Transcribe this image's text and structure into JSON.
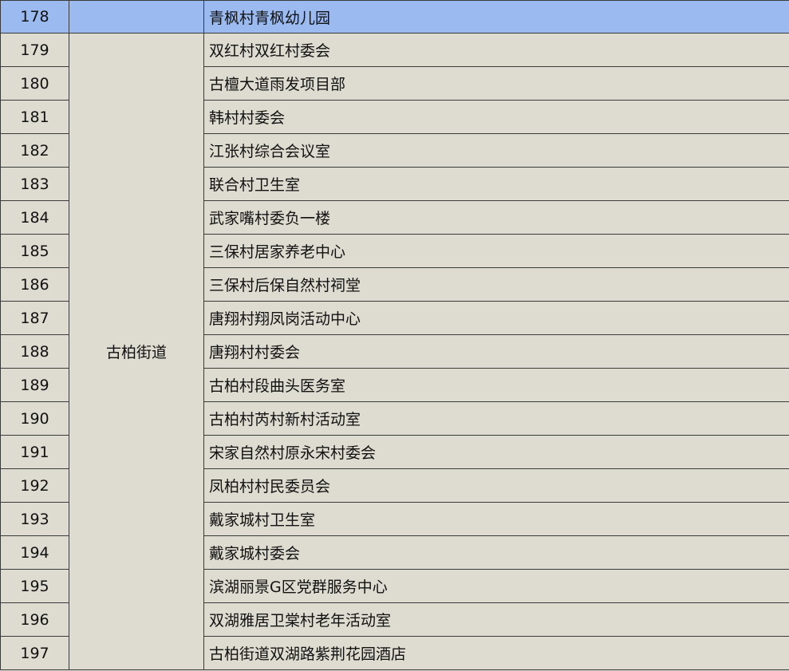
{
  "rows": [
    {
      "num": "178",
      "street": "",
      "location": "青枫村青枫幼儿园"
    },
    {
      "num": "179",
      "location": "双红村双红村委会"
    },
    {
      "num": "180",
      "location": "古檀大道雨发项目部"
    },
    {
      "num": "181",
      "location": "韩村村委会"
    },
    {
      "num": "182",
      "location": "江张村综合会议室"
    },
    {
      "num": "183",
      "location": "联合村卫生室"
    },
    {
      "num": "184",
      "location": "武家嘴村委负一楼"
    },
    {
      "num": "185",
      "location": "三保村居家养老中心"
    },
    {
      "num": "186",
      "location": "三保村后保自然村祠堂"
    },
    {
      "num": "187",
      "location": "唐翔村翔凤岗活动中心"
    },
    {
      "num": "188",
      "location": "唐翔村村委会"
    },
    {
      "num": "189",
      "location": "古柏村段曲头医务室"
    },
    {
      "num": "190",
      "location": "古柏村芮村新村活动室"
    },
    {
      "num": "191",
      "location": "宋家自然村原永宋村委会"
    },
    {
      "num": "192",
      "location": "凤柏村村民委员会"
    },
    {
      "num": "193",
      "location": "戴家城村卫生室"
    },
    {
      "num": "194",
      "location": "戴家城村委会"
    },
    {
      "num": "195",
      "location": "滨湖丽景G区党群服务中心"
    },
    {
      "num": "196",
      "location": "双湖雅居卫棠村老年活动室"
    },
    {
      "num": "197",
      "location": "古柏街道双湖路紫荆花园酒店"
    }
  ],
  "merged_street": "古柏街道",
  "colors": {
    "highlight_row": "#9bbaf0",
    "cell_bg": "#dedcd1",
    "border": "#3a3a3a"
  }
}
